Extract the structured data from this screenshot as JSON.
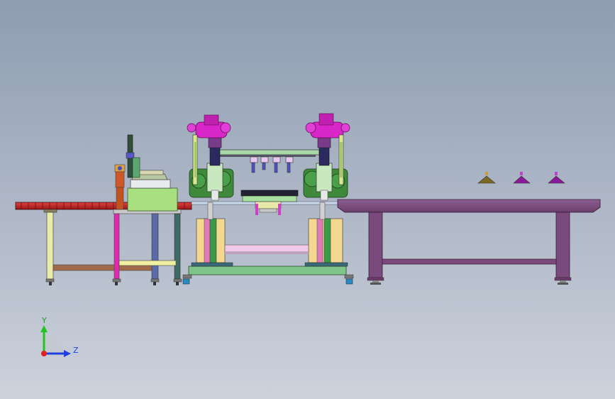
{
  "triad": {
    "y_label": "Y",
    "z_label": "Z",
    "colors": {
      "y_axis": "#22c422",
      "z_axis": "#1f3fe0",
      "x_axis": "#e02020"
    }
  },
  "colors": {
    "conveyor_belt": "#c8202a",
    "robot_body": "#d826c8",
    "robot_base": "#3f8a3a",
    "machine_frame": "#7fc48a",
    "worktable": "#7a4a7c",
    "cabinet": "#a8e080"
  }
}
